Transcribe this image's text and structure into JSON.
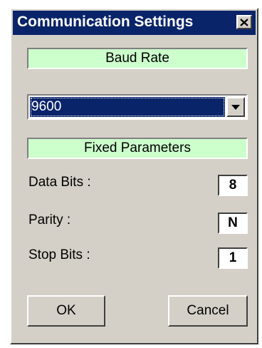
{
  "window": {
    "title": "Communication Settings"
  },
  "baud": {
    "header": "Baud Rate",
    "selected": "9600"
  },
  "fixed": {
    "header": "Fixed Parameters",
    "params": [
      {
        "label": "Data Bits :",
        "value": "8"
      },
      {
        "label": "Parity :",
        "value": "N"
      },
      {
        "label": "Stop Bits :",
        "value": "1"
      }
    ]
  },
  "buttons": {
    "ok": "OK",
    "cancel": "Cancel"
  },
  "icons": {
    "close": "close-icon",
    "dropdown": "chevron-down-icon"
  },
  "colors": {
    "titlebar": "#0a246a",
    "section_bg": "#ccffcc",
    "dialog_bg": "#d4d0c8",
    "selection": "#0a246a"
  }
}
